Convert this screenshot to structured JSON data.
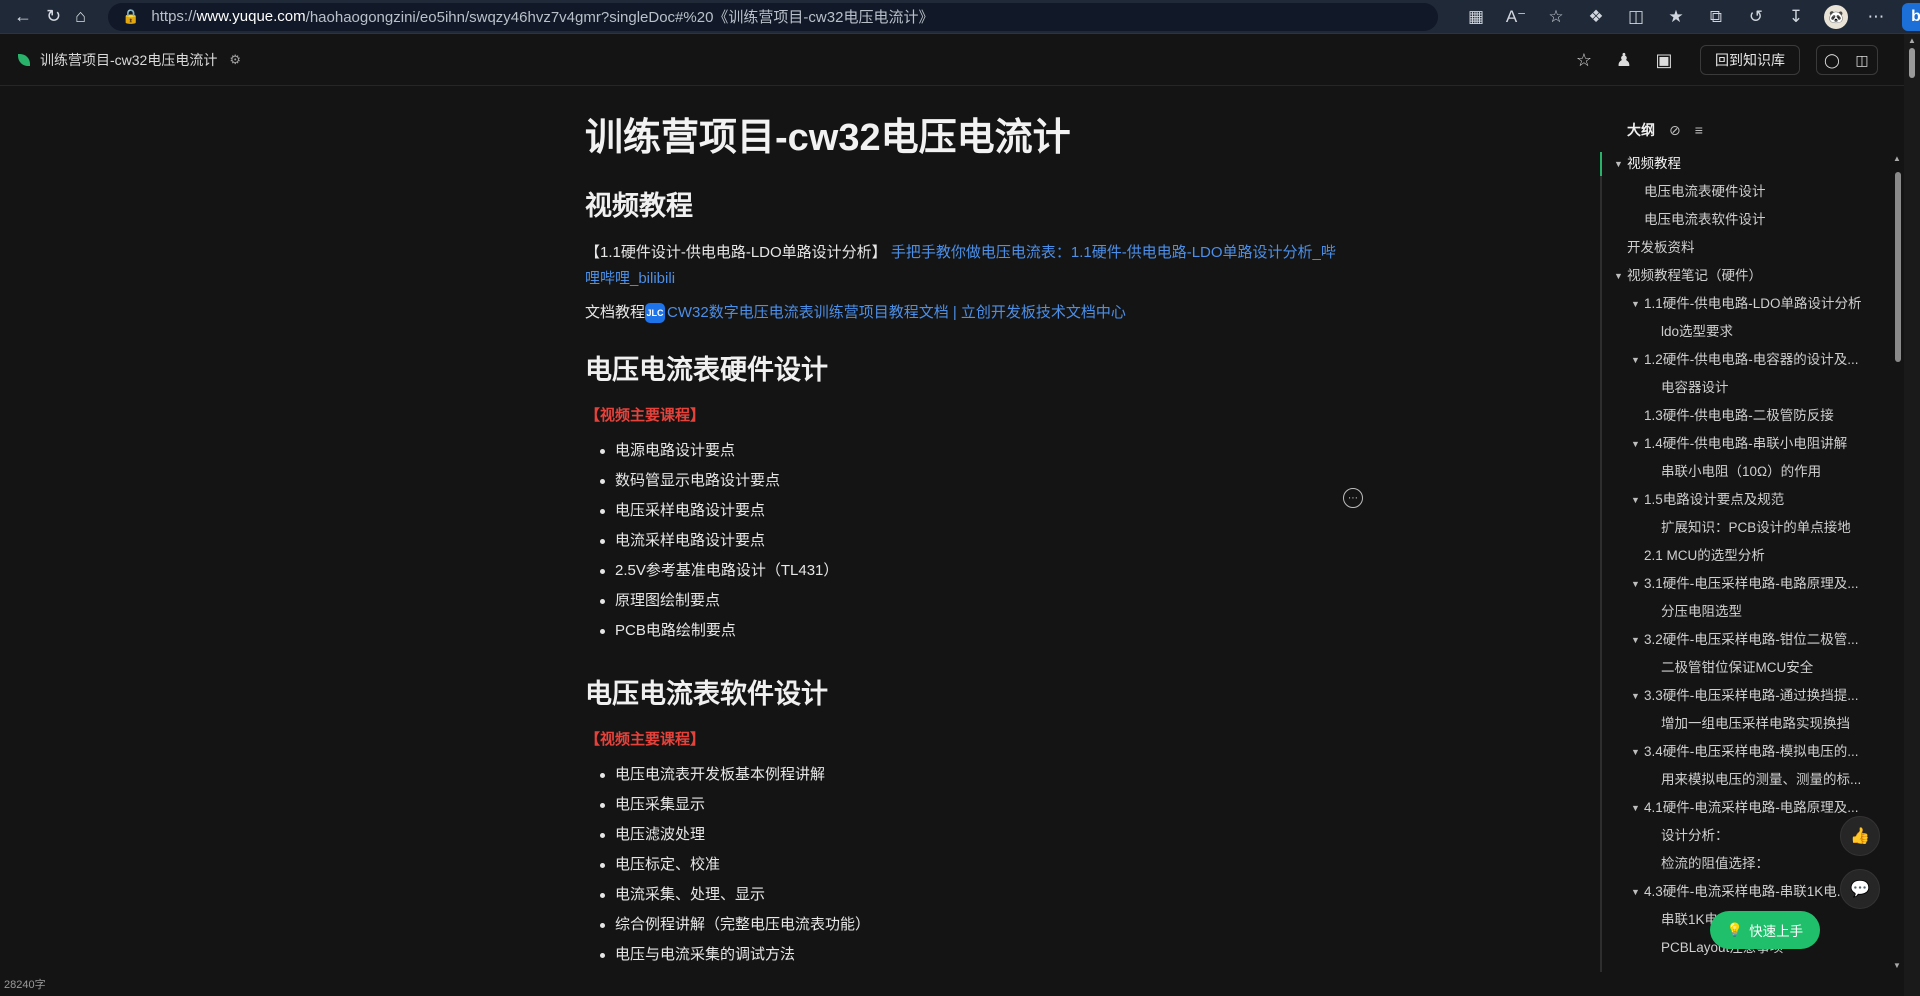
{
  "browser": {
    "url_prefix": "https://",
    "url_domain": "www.yuque.com",
    "url_rest": "/haohaogongzini/eo5ihn/swqzy46hvz7v4gmr?singleDoc#%20《训练营项目-cw32电压电流计》",
    "avatar_text": "🐼",
    "bing_text": "b"
  },
  "header": {
    "doc_title": "训练营项目-cw32电压电流计",
    "kb_button": "回到知识库"
  },
  "doc": {
    "title": "训练营项目-cw32电压电流计",
    "section1_heading": "视频教程",
    "video_prefix": "【1.1硬件设计-供电电路-LDO单路设计分析】",
    "video_link": "手把手教你做电压电流表：1.1硬件-供电电路-LDO单路设计分析_哔哩哔哩_bilibili",
    "docs_prefix": "文档教程",
    "jlc_badge": "JLC",
    "docs_link": "CW32数字电压电流表训练营项目教程文档 | 立创开发板技术文档中心",
    "section2_heading": "电压电流表硬件设计",
    "section2_label": "【视频主要课程】",
    "section2_items": [
      "电源电路设计要点",
      "数码管显示电路设计要点",
      "电压采样电路设计要点",
      "电流采样电路设计要点",
      "2.5V参考基准电路设计（TL431）",
      "原理图绘制要点",
      "PCB电路绘制要点"
    ],
    "section3_heading": "电压电流表软件设计",
    "section3_label": "【视频主要课程】",
    "section3_items": [
      "电压电流表开发板基本例程讲解",
      "电压采集显示",
      "电压滤波处理",
      "电压标定、校准",
      "电流采集、处理、显示",
      "综合例程讲解（完整电压电流表功能）",
      "电压与电流采集的调试方法"
    ]
  },
  "outline": {
    "title": "大纲",
    "items": [
      {
        "level": 1,
        "caret": true,
        "label": "视频教程",
        "active": true
      },
      {
        "level": 2,
        "caret": false,
        "label": "电压电流表硬件设计"
      },
      {
        "level": 2,
        "caret": false,
        "label": "电压电流表软件设计"
      },
      {
        "level": 1,
        "caret": false,
        "label": "开发板资料"
      },
      {
        "level": 1,
        "caret": true,
        "label": "视频教程笔记（硬件）"
      },
      {
        "level": 2,
        "caret": true,
        "label": "1.1硬件-供电电路-LDO单路设计分析"
      },
      {
        "level": 3,
        "caret": false,
        "label": "ldo选型要求"
      },
      {
        "level": 2,
        "caret": true,
        "label": "1.2硬件-供电电路-电容器的设计及..."
      },
      {
        "level": 3,
        "caret": false,
        "label": "电容器设计"
      },
      {
        "level": 2,
        "caret": false,
        "label": "1.3硬件-供电电路-二极管防反接"
      },
      {
        "level": 2,
        "caret": true,
        "label": "1.4硬件-供电电路-串联小电阻讲解"
      },
      {
        "level": 3,
        "caret": false,
        "label": "串联小电阻（10Ω）的作用"
      },
      {
        "level": 2,
        "caret": true,
        "label": "1.5电路设计要点及规范"
      },
      {
        "level": 3,
        "caret": false,
        "label": "扩展知识：PCB设计的单点接地"
      },
      {
        "level": 2,
        "caret": false,
        "label": "2.1 MCU的选型分析"
      },
      {
        "level": 2,
        "caret": true,
        "label": "3.1硬件-电压采样电路-电路原理及..."
      },
      {
        "level": 3,
        "caret": false,
        "label": "分压电阻选型"
      },
      {
        "level": 2,
        "caret": true,
        "label": "3.2硬件-电压采样电路-钳位二极管..."
      },
      {
        "level": 3,
        "caret": false,
        "label": "二极管钳位保证MCU安全"
      },
      {
        "level": 2,
        "caret": true,
        "label": "3.3硬件-电压采样电路-通过换挡提..."
      },
      {
        "level": 3,
        "caret": false,
        "label": "增加一组电压采样电路实现换挡"
      },
      {
        "level": 2,
        "caret": true,
        "label": "3.4硬件-电压采样电路-模拟电压的..."
      },
      {
        "level": 3,
        "caret": false,
        "label": "用来模拟电压的测量、测量的标..."
      },
      {
        "level": 2,
        "caret": true,
        "label": "4.1硬件-电流采样电路-电路原理及..."
      },
      {
        "level": 3,
        "caret": false,
        "label": "设计分析："
      },
      {
        "level": 3,
        "caret": false,
        "label": "检流的阻值选择："
      },
      {
        "level": 2,
        "caret": true,
        "label": "4.3硬件-电流采样电路-串联1K电..."
      },
      {
        "level": 3,
        "caret": false,
        "label": "串联1K电..."
      },
      {
        "level": 3,
        "caret": false,
        "label": "PCBLayout注意事项"
      }
    ]
  },
  "quick_start": "快速上手",
  "word_count": "28240字"
}
